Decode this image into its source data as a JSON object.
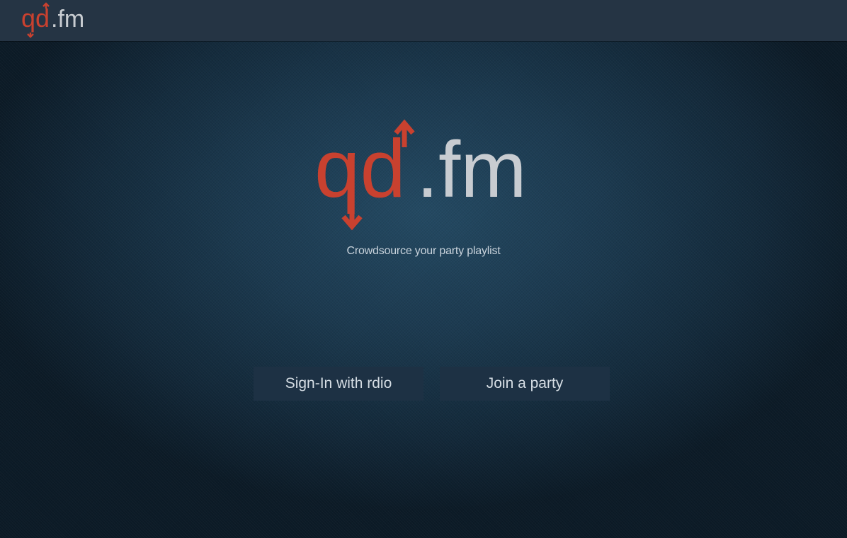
{
  "brand": {
    "logo_part1": "qd",
    "logo_part2": ".fm",
    "accent_color": "#c9412f",
    "light_color": "#c8ccd1"
  },
  "hero": {
    "tagline": "Crowdsource your party playlist"
  },
  "actions": {
    "signin_label": "Sign-In with rdio",
    "join_label": "Join a party"
  }
}
